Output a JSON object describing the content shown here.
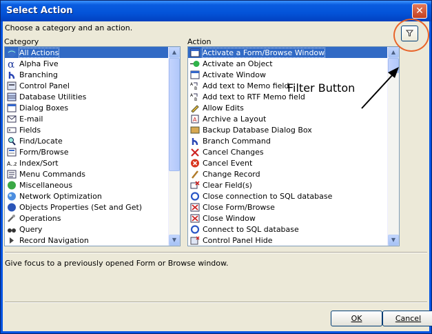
{
  "window": {
    "title": "Select Action"
  },
  "instructions": "Choose a category and an action.",
  "category": {
    "label": "Category",
    "items": [
      {
        "label": "All Actions",
        "icon": "globe-icon",
        "selected": true
      },
      {
        "label": "Alpha Five",
        "icon": "alpha-icon"
      },
      {
        "label": "Branching",
        "icon": "branch-icon"
      },
      {
        "label": "Control Panel",
        "icon": "control-panel-icon"
      },
      {
        "label": "Database Utilities",
        "icon": "database-icon"
      },
      {
        "label": "Dialog Boxes",
        "icon": "dialog-icon"
      },
      {
        "label": "E-mail",
        "icon": "email-icon"
      },
      {
        "label": "Fields",
        "icon": "field-icon"
      },
      {
        "label": "Find/Locate",
        "icon": "find-icon"
      },
      {
        "label": "Form/Browse",
        "icon": "form-icon"
      },
      {
        "label": "Index/Sort",
        "icon": "index-sort-icon"
      },
      {
        "label": "Menu Commands",
        "icon": "menu-icon"
      },
      {
        "label": "Miscellaneous",
        "icon": "misc-icon"
      },
      {
        "label": "Network Optimization",
        "icon": "network-icon"
      },
      {
        "label": "Objects Properties (Set and Get)",
        "icon": "objects-icon"
      },
      {
        "label": "Operations",
        "icon": "operations-icon"
      },
      {
        "label": "Query",
        "icon": "query-icon"
      },
      {
        "label": "Record Navigation",
        "icon": "navigation-icon"
      }
    ]
  },
  "action": {
    "label": "Action",
    "items": [
      {
        "label": "Activate a Form/Browse Window",
        "icon": "form-window-icon",
        "selected": true
      },
      {
        "label": "Activate an Object",
        "icon": "object-icon"
      },
      {
        "label": "Activate Window",
        "icon": "window-icon"
      },
      {
        "label": "Add text to Memo field",
        "icon": "memo-icon"
      },
      {
        "label": "Add text to RTF Memo field",
        "icon": "rtf-memo-icon"
      },
      {
        "label": "Allow Edits",
        "icon": "edit-icon"
      },
      {
        "label": "Archive a Layout",
        "icon": "archive-icon"
      },
      {
        "label": "Backup Database Dialog Box",
        "icon": "backup-icon"
      },
      {
        "label": "Branch Command",
        "icon": "branch-icon"
      },
      {
        "label": "Cancel Changes",
        "icon": "cancel-changes-icon"
      },
      {
        "label": "Cancel Event",
        "icon": "cancel-event-icon"
      },
      {
        "label": "Change Record",
        "icon": "pencil-icon"
      },
      {
        "label": "Clear Field(s)",
        "icon": "clear-field-icon"
      },
      {
        "label": "Close connection to SQL database",
        "icon": "sql-close-icon"
      },
      {
        "label": "Close Form/Browse",
        "icon": "close-form-icon"
      },
      {
        "label": "Close Window",
        "icon": "close-window-icon"
      },
      {
        "label": "Connect to SQL database",
        "icon": "sql-connect-icon"
      },
      {
        "label": "Control Panel Hide",
        "icon": "control-panel-hide-icon"
      }
    ]
  },
  "annotation": {
    "text": "Filter Button"
  },
  "description": "Give focus to a previously opened Form or Browse window.",
  "buttons": {
    "ok": "OK",
    "cancel": "Cancel"
  },
  "colors": {
    "selection": "#316ac5",
    "annotation_circle": "#e8642a",
    "titlebar": "#0353d8"
  }
}
